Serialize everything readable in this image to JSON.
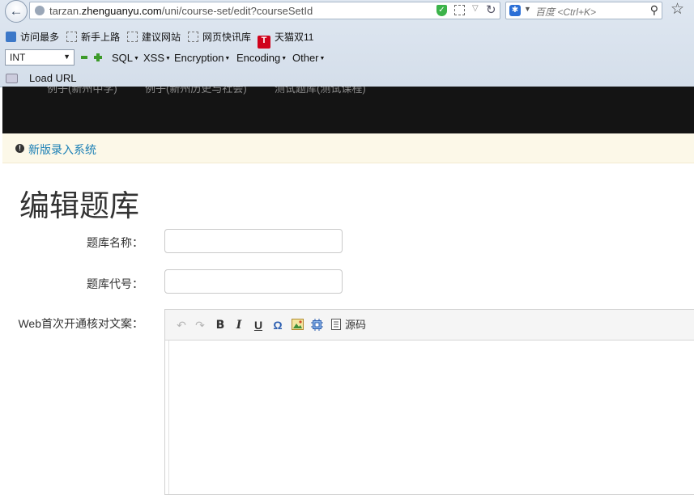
{
  "browser": {
    "url_prefix": "tarzan.",
    "url_domain": "zhenguanyu.com",
    "url_path": "/uni/course-set/edit?courseSetId",
    "search_placeholder": "百度 <Ctrl+K>"
  },
  "bookmarks": [
    {
      "label": "访问最多"
    },
    {
      "label": "新手上路"
    },
    {
      "label": "建议网站"
    },
    {
      "label": "网页快讯库"
    },
    {
      "label": "天猫双11",
      "icon_text": "T"
    }
  ],
  "hackbar": {
    "select_value": "INT",
    "menus": [
      "SQL",
      "XSS",
      "Encryption",
      "Encoding",
      "Other"
    ],
    "load_url": "Load URL"
  },
  "site": {
    "header_nav_partial": [
      "例子(新州中学)",
      "例子(新州历史与社会)",
      "测试题库(测试课程)"
    ]
  },
  "notice": {
    "icon": "exclamation-circle-icon",
    "link_text": "新版录入系统"
  },
  "page": {
    "title": "编辑题库"
  },
  "form": {
    "name_label": "题库名称：",
    "name_value": "",
    "code_label": "题库代号：",
    "code_value": "",
    "web_copy_label": "Web首次开通核对文案："
  },
  "editor": {
    "toolbar": {
      "undo": "↶",
      "redo": "↷",
      "bold": "B",
      "italic": "I",
      "underline": "U",
      "special_char": "Ω",
      "source_label": "源码"
    }
  },
  "colors": {
    "header_bg": "#141414",
    "notice_bg": "#fcf8e8",
    "link": "#1a7fb5"
  }
}
